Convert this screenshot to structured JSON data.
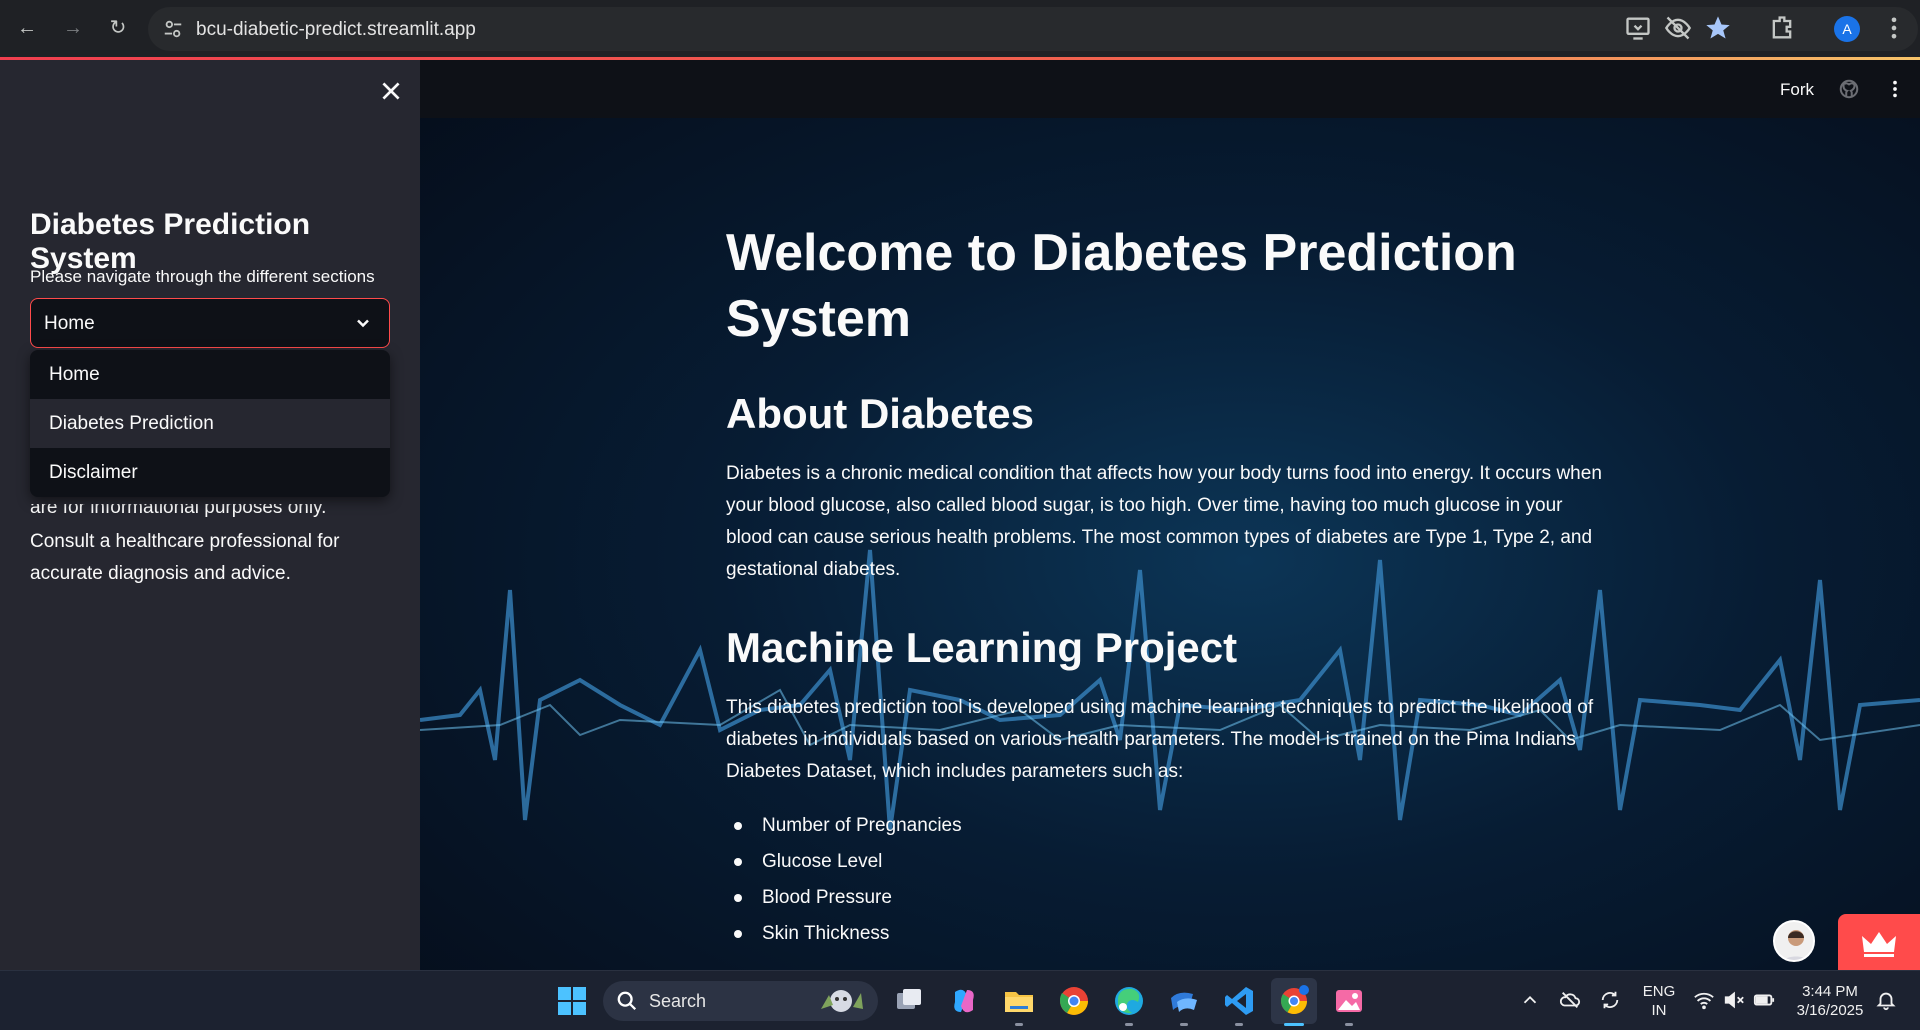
{
  "browser": {
    "url": "bcu-diabetic-predict.streamlit.app",
    "profile_initial": "A"
  },
  "app_header": {
    "fork_label": "Fork"
  },
  "sidebar": {
    "title": "Diabetes Prediction System",
    "caption": "Please navigate through the different sections",
    "select_value": "Home",
    "options": [
      "Home",
      "Diabetes Prediction",
      "Disclaimer"
    ],
    "hovered_option": "Diabetes Prediction",
    "note_clipped_line": "are for informational purposes only.",
    "note_line_1": "Consult a healthcare professional for",
    "note_line_2": "accurate diagnosis and advice."
  },
  "main": {
    "title": "Welcome to Diabetes Prediction System",
    "about_heading": "About Diabetes",
    "about_text": "Diabetes is a chronic medical condition that affects how your body turns food into energy. It occurs when your blood glucose, also called blood sugar, is too high. Over time, having too much glucose in your blood can cause serious health problems. The most common types of diabetes are Type 1, Type 2, and gestational diabetes.",
    "ml_heading": "Machine Learning Project",
    "ml_text": "This diabetes prediction tool is developed using machine learning techniques to predict the likelihood of diabetes in individuals based on various health parameters. The model is trained on the Pima Indians Diabetes Dataset, which includes parameters such as:",
    "parameters": [
      "Number of Pregnancies",
      "Glucose Level",
      "Blood Pressure",
      "Skin Thickness"
    ]
  },
  "taskbar": {
    "search_label": "Search",
    "lang_line_1": "ENG",
    "lang_line_2": "IN",
    "time": "3:44 PM",
    "date": "3/16/2025"
  },
  "colors": {
    "accent": "#ff4b4b",
    "sidebar_bg": "#262730",
    "app_bg": "#0e1117"
  }
}
